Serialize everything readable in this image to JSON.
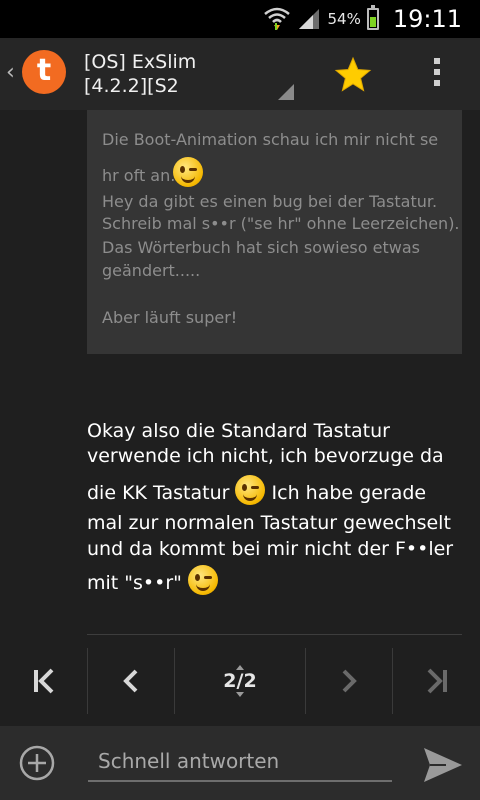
{
  "status_bar": {
    "battery_percent": "54%",
    "battery_level": 0.54,
    "time": "19:11",
    "icons": [
      "wifi-icon",
      "signal-icon",
      "battery-icon"
    ]
  },
  "action_bar": {
    "title_line1": "[OS] ExSlim",
    "title_line2": "[4.2.2][S2",
    "logo_letter": "t",
    "icons": [
      "back-chevron-icon",
      "tapatalk-logo",
      "star-icon",
      "overflow-menu-icon"
    ]
  },
  "quote": {
    "line1": "Die Boot-Animation schau ich mir nicht se",
    "line2": "hr oft an.",
    "line3": "Hey da gibt es einen bug bei der Tastatur.",
    "line4": "Schreib mal s••r (\"se hr\" ohne Leerzeichen).",
    "line5": "Das Wörterbuch hat sich sowieso etwas",
    "line6": "geändert.....",
    "line7": "Aber läuft super!"
  },
  "post": {
    "line1": "Okay also die Standard Tastatur",
    "line2": "verwende ich nicht, ich bevorzuge da",
    "line3a": "die KK Tastatur",
    "line3b": "Ich habe gerade",
    "line4": "mal zur normalen Tastatur gewechselt",
    "line5": "und da kommt bei mir nicht der F••ler",
    "line6": "mit \"s••r\""
  },
  "pagination": {
    "current_page": 2,
    "total_pages": 2,
    "label": "2/2"
  },
  "reply": {
    "placeholder": "Schnell antworten"
  },
  "colors": {
    "accent_orange": "#f26b21",
    "star_yellow": "#ffcc00",
    "battery_green": "#7ed321"
  }
}
